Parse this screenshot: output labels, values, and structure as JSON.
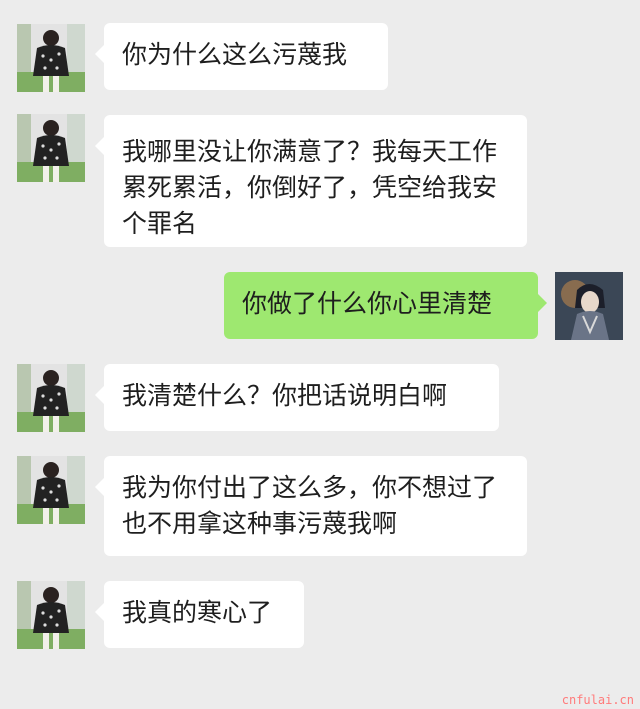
{
  "messages": [
    {
      "side": "in",
      "text": "你为什么这么污蔑我"
    },
    {
      "side": "in",
      "text": "我哪里没让你满意了？我每天工作累死累活，你倒好了，凭空给我安个罪名"
    },
    {
      "side": "out",
      "text": "你做了什么你心里清楚"
    },
    {
      "side": "in",
      "text": "我清楚什么？你把话说明白啊"
    },
    {
      "side": "in",
      "text": "我为你付出了这么多，你不想过了也不用拿这种事污蔑我啊"
    },
    {
      "side": "in",
      "text": "我真的寒心了"
    }
  ],
  "watermark": "cnfulai.cn",
  "colors": {
    "background": "#ececec",
    "incoming_bubble": "#ffffff",
    "outgoing_bubble": "#9ee870"
  }
}
